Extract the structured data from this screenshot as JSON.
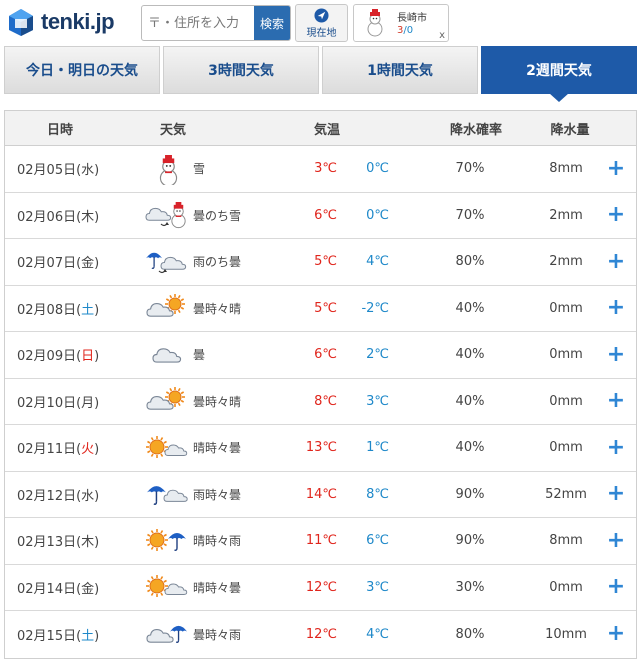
{
  "header": {
    "logo_text": "tenki.jp",
    "search_placeholder": "〒・住所を入力",
    "search_button": "検索",
    "location_button": "現在地",
    "favorite": {
      "city": "長崎市",
      "high": "3",
      "sep": "/",
      "low": "0",
      "close": "x"
    }
  },
  "tabs": [
    {
      "label": "今日・明日の天気",
      "active": false
    },
    {
      "label": "3時間天気",
      "active": false
    },
    {
      "label": "1時間天気",
      "active": false
    },
    {
      "label": "2週間天気",
      "active": true
    }
  ],
  "table": {
    "headers": {
      "date": "日時",
      "weather": "天気",
      "temp": "気温",
      "prob": "降水確率",
      "amount": "降水量"
    },
    "expand_symbol": "+",
    "rows": [
      {
        "date_pre": "02月05日(",
        "dow": "水",
        "date_post": ")",
        "dow_type": "weekday",
        "icon": "snow-icon",
        "weather": "雪",
        "high": "3℃",
        "low": "0℃",
        "prob": "70%",
        "amount": "8mm"
      },
      {
        "date_pre": "02月06日(",
        "dow": "木",
        "date_post": ")",
        "dow_type": "weekday",
        "icon": "cloudy-then-snow-icon",
        "weather": "曇のち雪",
        "high": "6℃",
        "low": "0℃",
        "prob": "70%",
        "amount": "2mm"
      },
      {
        "date_pre": "02月07日(",
        "dow": "金",
        "date_post": ")",
        "dow_type": "weekday",
        "icon": "rain-then-cloudy-icon",
        "weather": "雨のち曇",
        "high": "5℃",
        "low": "4℃",
        "prob": "80%",
        "amount": "2mm"
      },
      {
        "date_pre": "02月08日(",
        "dow": "土",
        "date_post": ")",
        "dow_type": "saturday",
        "icon": "cloudy-sometimes-sunny-icon",
        "weather": "曇時々晴",
        "high": "5℃",
        "low": "-2℃",
        "prob": "40%",
        "amount": "0mm"
      },
      {
        "date_pre": "02月09日(",
        "dow": "日",
        "date_post": ")",
        "dow_type": "sunday",
        "icon": "cloudy-icon",
        "weather": "曇",
        "high": "6℃",
        "low": "2℃",
        "prob": "40%",
        "amount": "0mm"
      },
      {
        "date_pre": "02月10日(",
        "dow": "月",
        "date_post": ")",
        "dow_type": "weekday",
        "icon": "cloudy-sometimes-sunny-icon",
        "weather": "曇時々晴",
        "high": "8℃",
        "low": "3℃",
        "prob": "40%",
        "amount": "0mm"
      },
      {
        "date_pre": "02月11日(",
        "dow": "火",
        "date_post": ")",
        "dow_type": "sunday",
        "icon": "sunny-sometimes-cloudy-icon",
        "weather": "晴時々曇",
        "high": "13℃",
        "low": "1℃",
        "prob": "40%",
        "amount": "0mm"
      },
      {
        "date_pre": "02月12日(",
        "dow": "水",
        "date_post": ")",
        "dow_type": "weekday",
        "icon": "rain-sometimes-cloudy-icon",
        "weather": "雨時々曇",
        "high": "14℃",
        "low": "8℃",
        "prob": "90%",
        "amount": "52mm"
      },
      {
        "date_pre": "02月13日(",
        "dow": "木",
        "date_post": ")",
        "dow_type": "weekday",
        "icon": "sunny-sometimes-rain-icon",
        "weather": "晴時々雨",
        "high": "11℃",
        "low": "6℃",
        "prob": "90%",
        "amount": "8mm"
      },
      {
        "date_pre": "02月14日(",
        "dow": "金",
        "date_post": ")",
        "dow_type": "weekday",
        "icon": "sunny-sometimes-cloudy-icon",
        "weather": "晴時々曇",
        "high": "12℃",
        "low": "3℃",
        "prob": "30%",
        "amount": "0mm"
      },
      {
        "date_pre": "02月15日(",
        "dow": "土",
        "date_post": ")",
        "dow_type": "saturday",
        "icon": "cloudy-sometimes-rain-icon",
        "weather": "曇時々雨",
        "high": "12℃",
        "low": "4℃",
        "prob": "80%",
        "amount": "10mm"
      }
    ]
  }
}
